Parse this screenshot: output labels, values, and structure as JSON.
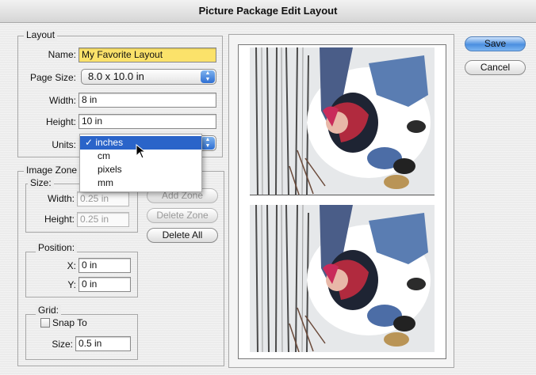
{
  "window": {
    "title": "Picture Package Edit Layout"
  },
  "layout_group": {
    "title": "Layout",
    "name_label": "Name:",
    "name_value": "My Favorite Layout",
    "page_size_label": "Page Size:",
    "page_size_value": "8.0 x 10.0 in",
    "width_label": "Width:",
    "width_value": "8 in",
    "height_label": "Height:",
    "height_value": "10 in",
    "units_label": "Units:"
  },
  "units_menu": {
    "items": [
      {
        "label": "✓ inches",
        "selected": true
      },
      {
        "label": "cm",
        "selected": false
      },
      {
        "label": "pixels",
        "selected": false
      },
      {
        "label": "mm",
        "selected": false
      }
    ]
  },
  "image_zone": {
    "title": "Image Zone",
    "size_title": "Size:",
    "width_label": "Width:",
    "width_value": "0.25 in",
    "height_label": "Height:",
    "height_value": "0.25 in",
    "add_zone": "Add Zone",
    "delete_zone": "Delete Zone",
    "delete_all": "Delete All",
    "position_title": "Position:",
    "x_label": "X:",
    "x_value": "0 in",
    "y_label": "Y:",
    "y_value": "0 in",
    "grid_title": "Grid:",
    "snap_label": "Snap To",
    "grid_size_label": "Size:",
    "grid_size_value": "0.5 in"
  },
  "buttons": {
    "save": "Save",
    "cancel": "Cancel"
  },
  "colors": {
    "selection": "#2a64c9",
    "name_highlight": "#fbe26a",
    "default_button": "#4b8fe0"
  },
  "icons": [
    "checkmark-icon",
    "popup-arrows-icon",
    "mouse-cursor-icon",
    "checkbox-icon"
  ]
}
